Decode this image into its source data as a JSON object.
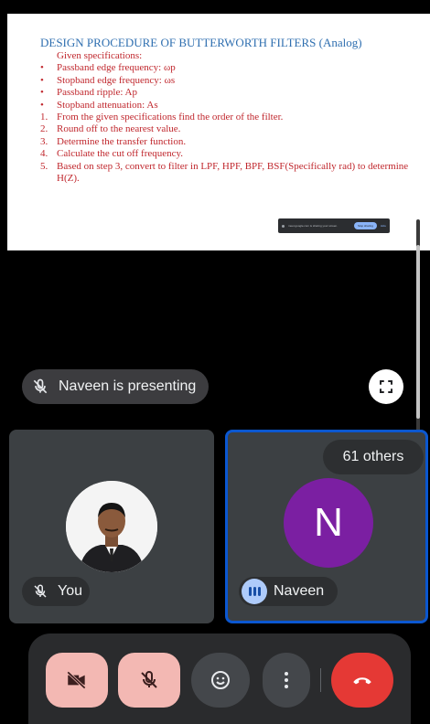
{
  "slide": {
    "title": "DESIGN PROCEDURE OF BUTTERWORTH FILTERS (Analog)",
    "lines": [
      {
        "marker": "",
        "text": "Given specifications:"
      },
      {
        "marker": "•",
        "text": "Passband edge frequency: ωp"
      },
      {
        "marker": "•",
        "text": "Stopband edge frequency: ωs"
      },
      {
        "marker": "•",
        "text": "Passband ripple: Ap"
      },
      {
        "marker": "•",
        "text": "Stopband attenuation: As"
      },
      {
        "marker": "1.",
        "text": "From the given specifications find the order of the filter."
      },
      {
        "marker": "2.",
        "text": "Round off to the nearest value."
      },
      {
        "marker": "3.",
        "text": "Determine the transfer function."
      },
      {
        "marker": "4.",
        "text": "Calculate the cut off frequency."
      },
      {
        "marker": "5.",
        "text": "Based on step 3, convert to filter in LPF, HPF, BPF, BSF(Specifically rad) to determine H(Z)."
      }
    ],
    "share_bar": {
      "message": "meet.google.com is sharing your screen.",
      "stop_label": "Stop sharing",
      "hide_label": "Hide"
    }
  },
  "presenter": {
    "label": "Naveen is presenting"
  },
  "tiles": {
    "self": {
      "name": "You"
    },
    "speaker": {
      "name": "Naveen",
      "initial": "N",
      "avatar_color": "#7b1fa2"
    },
    "others_label": "61 others"
  },
  "controls": {
    "camera": "camera-off",
    "mic": "mic-off",
    "reactions": "emoji",
    "more": "more-options",
    "end_call": "end-call"
  }
}
